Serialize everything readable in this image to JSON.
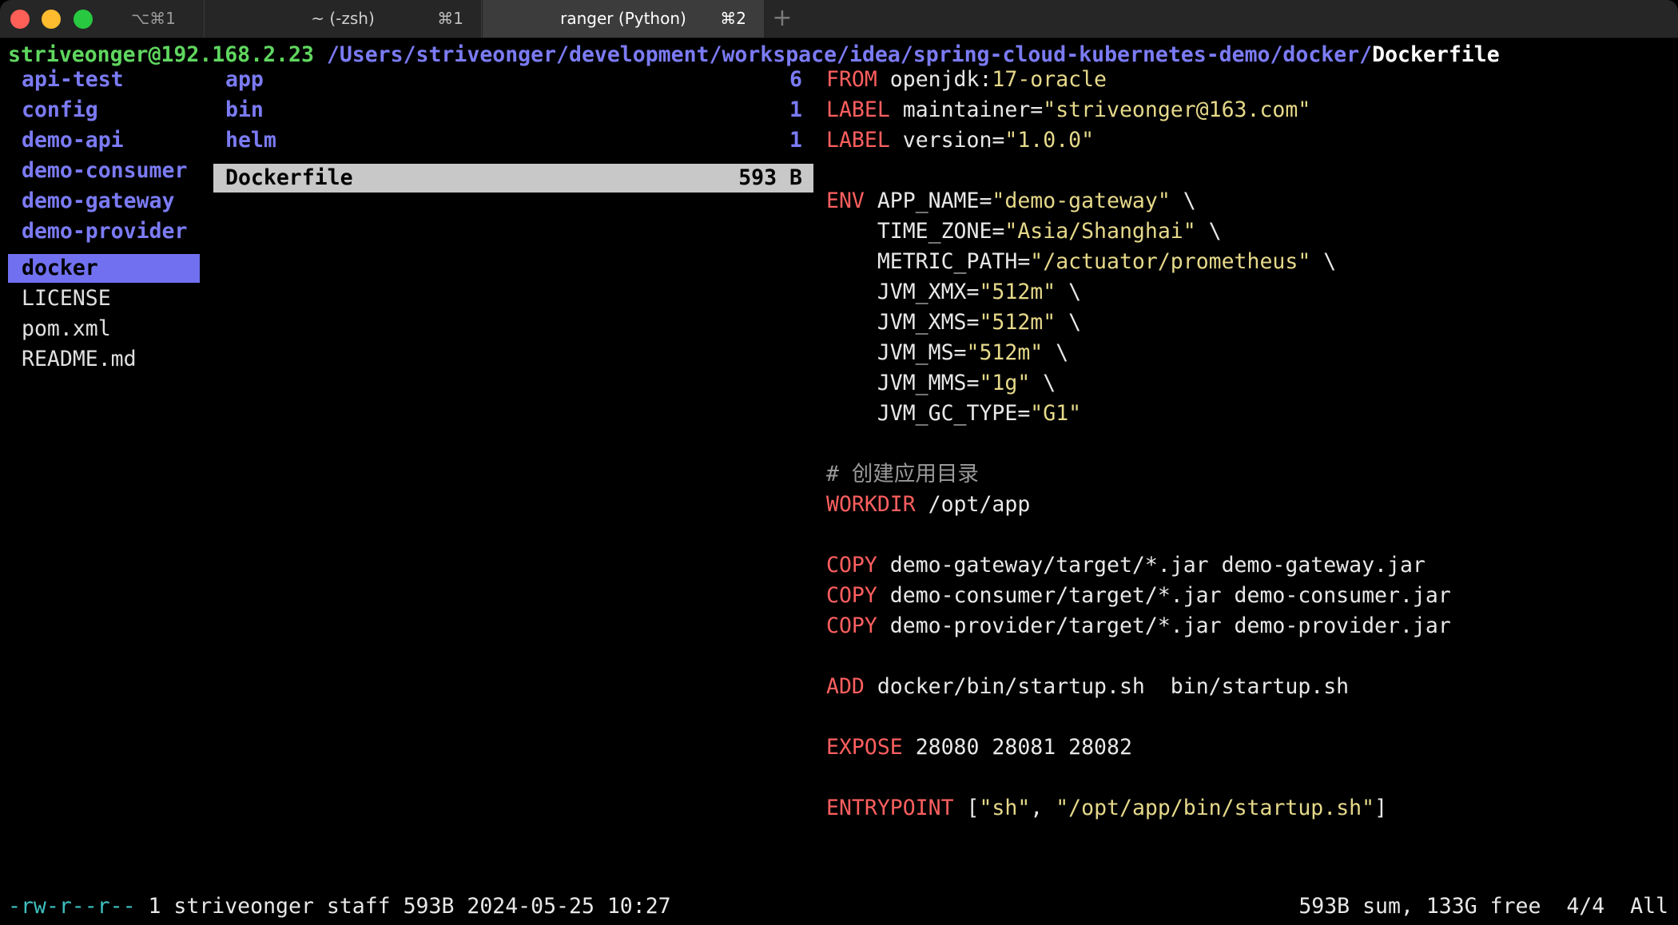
{
  "window": {
    "tabs": [
      {
        "title": "⌥⌘1",
        "shortcut": ""
      },
      {
        "title": "~ (-zsh)",
        "shortcut": "⌘1"
      },
      {
        "title": "ranger (Python)",
        "shortcut": "⌘2",
        "active": true
      }
    ],
    "new_tab_label": "+"
  },
  "header": {
    "host": "striveonger@192.168.2.23",
    "path": " /Users/striveonger/development/workspace/idea/spring-cloud-kubernetes-demo/docker/",
    "file": "Dockerfile"
  },
  "parent_column": [
    {
      "name": "api-test",
      "type": "dir"
    },
    {
      "name": "config",
      "type": "dir"
    },
    {
      "name": "demo-api",
      "type": "dir"
    },
    {
      "name": "demo-consumer",
      "type": "dir"
    },
    {
      "name": "demo-gateway",
      "type": "dir"
    },
    {
      "name": "demo-provider",
      "type": "dir"
    },
    {
      "name": "docker",
      "type": "dir",
      "selected": true
    },
    {
      "name": "LICENSE",
      "type": "file"
    },
    {
      "name": "pom.xml",
      "type": "file"
    },
    {
      "name": "README.md",
      "type": "file"
    }
  ],
  "current_column": [
    {
      "name": "app",
      "info": "6",
      "type": "dir"
    },
    {
      "name": "bin",
      "info": "1",
      "type": "dir"
    },
    {
      "name": "helm",
      "info": "1",
      "type": "dir"
    },
    {
      "name": "Dockerfile",
      "info": "593 B",
      "type": "file",
      "selected": true
    }
  ],
  "preview": {
    "lines": [
      [
        "FROM",
        " openjdk:",
        "17-oracle"
      ],
      [
        "LABEL",
        " maintainer=",
        "\"striveonger@163.com\""
      ],
      [
        "LABEL",
        " version=",
        "\"1.0.0\""
      ],
      [
        "ENV",
        " APP_NAME=",
        "\"demo-gateway\"",
        " \\"
      ],
      [
        "    TIME_ZONE=",
        "\"Asia/Shanghai\"",
        " \\"
      ],
      [
        "    METRIC_PATH=",
        "\"/actuator/prometheus\"",
        " \\"
      ],
      [
        "    JVM_XMX=",
        "\"512m\"",
        " \\"
      ],
      [
        "    JVM_XMS=",
        "\"512m\"",
        " \\"
      ],
      [
        "    JVM_MS=",
        "\"512m\"",
        " \\"
      ],
      [
        "    JVM_MMS=",
        "\"1g\"",
        " \\"
      ],
      [
        "    JVM_GC_TYPE=",
        "\"G1\""
      ],
      [
        "# 创建应用目录"
      ],
      [
        "WORKDIR",
        " /opt/app"
      ],
      [
        "COPY",
        " demo-gateway/target/*.jar demo-gateway.jar"
      ],
      [
        "COPY",
        " demo-consumer/target/*.jar demo-consumer.jar"
      ],
      [
        "COPY",
        " demo-provider/target/*.jar demo-provider.jar"
      ],
      [
        "ADD",
        " docker/bin/startup.sh  bin/startup.sh"
      ],
      [
        "EXPOSE",
        " 28080 28081 28082"
      ],
      [
        "ENTRYPOINT",
        " [",
        "\"sh\"",
        ", ",
        "\"/opt/app/bin/startup.sh\"",
        "]"
      ]
    ]
  },
  "status": {
    "permissions": "-rw-r--r--",
    "details": " 1 striveonger staff 593B 2024-05-25 10:27",
    "right": "593B sum, 133G free  4/4  All"
  },
  "colors": {
    "directory": "#7b7bf5",
    "host": "#5fd75f",
    "keyword": "#ff5f5f",
    "string": "#e6d98a",
    "selection_dir": "#7070f0",
    "selection_file": "#c8c8c8",
    "permissions": "#3fc0c0"
  }
}
